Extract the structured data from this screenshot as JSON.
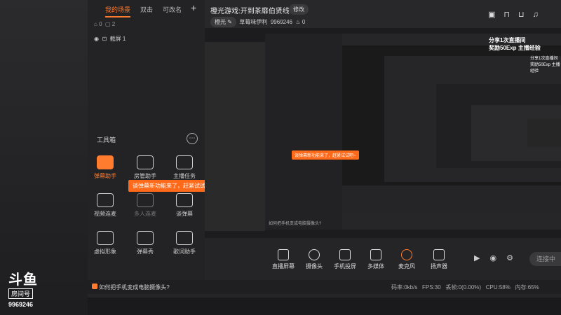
{
  "scene_tabs": [
    "我的场景",
    "双击",
    "可改名"
  ],
  "scene_counts": {
    "a": "0",
    "b": "2"
  },
  "source_item": "截屏 1",
  "toolbox": {
    "title": "工具箱",
    "tools": [
      {
        "label": "弹幕助手",
        "active": true
      },
      {
        "label": "房管助手",
        "active": false
      },
      {
        "label": "主播任务",
        "active": false
      },
      {
        "label": "视频连麦",
        "active": false
      },
      {
        "label": "多人连麦",
        "active": false
      },
      {
        "label": "谈弹幕",
        "active": false
      },
      {
        "label": "虚拟形象",
        "active": false
      },
      {
        "label": "弹幕秀",
        "active": false
      },
      {
        "label": "歌词助手",
        "active": false
      }
    ]
  },
  "tip": {
    "text": "谈弹幕新功能来了，赶紧试试吧~",
    "close": "×"
  },
  "header": {
    "title": "橙光游戏:开到茶靡伯贤线",
    "edit": "修改",
    "category": "橙光",
    "category_edit": "✎",
    "name": "草莓味伊利",
    "room_id": "9969246",
    "heat": "0"
  },
  "notice": {
    "line1": "分享1次直播间",
    "line2": "奖励50Exp 主播经验"
  },
  "bottom_tools": [
    "直播屏幕",
    "摄像头",
    "手机投屏",
    "多媒体",
    "麦克风",
    "扬声器"
  ],
  "start_button": "连接中",
  "status": {
    "hint": "如何把手机变成电脑摄像头?",
    "bitrate": "码率:0kb/s",
    "fps": "FPS:30",
    "drop": "丢帧:0(0.00%)",
    "cpu": "CPU:58%",
    "mem": "内存:65%"
  },
  "logo": {
    "brand": "斗鱼",
    "tag": "房间号",
    "room": "9969246"
  },
  "nested_tip": "谈弹幕新功能来了，赶紧试试吧~",
  "nested_hint": "如何把手机变成电脑摄像头?",
  "nested_notice": {
    "line1": "分享1次直播间",
    "line2": "奖励50Exp 主播经验"
  }
}
